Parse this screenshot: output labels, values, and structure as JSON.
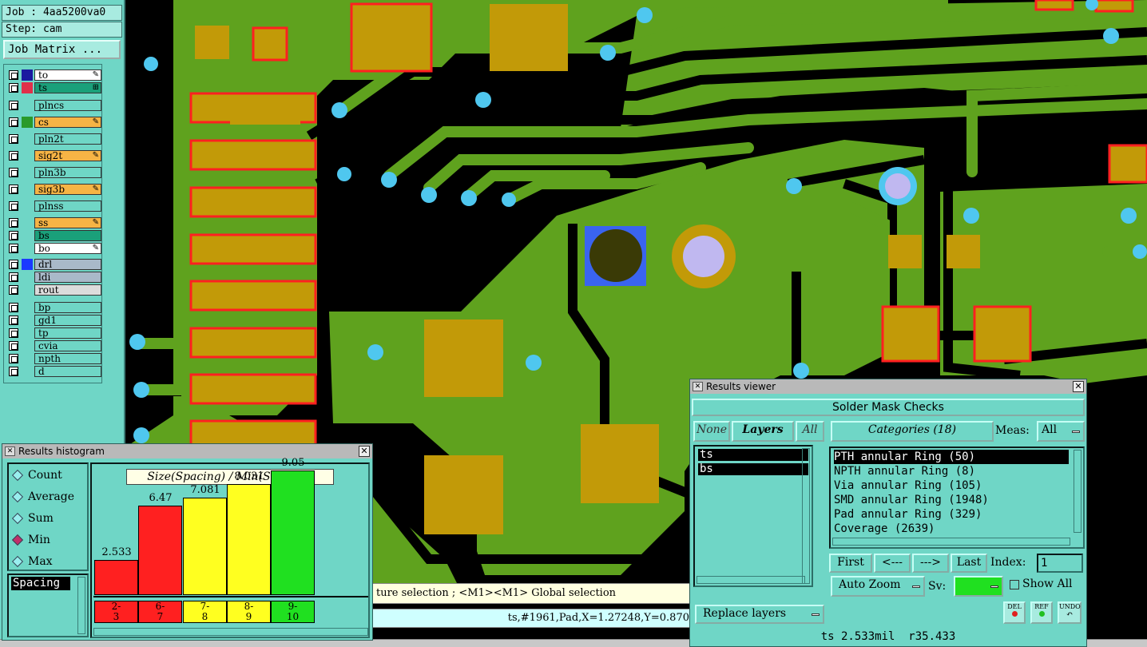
{
  "job": {
    "job_label": "Job : 4aa5200va0",
    "step_label": "Step: cam",
    "matrix_button": "Job Matrix ..."
  },
  "layers": [
    {
      "name": "to",
      "color": "#ffffff",
      "mark": "edit",
      "sel_color": "#1a1aa0"
    },
    {
      "name": "ts",
      "color": "#1aa07a",
      "mark": "grid",
      "sel_color": "#e0304a"
    },
    {
      "name": "plncs",
      "color": "#6fd6c6",
      "mark": "",
      "sel_color": ""
    },
    {
      "name": "cs",
      "color": "#f6b445",
      "mark": "edit",
      "sel_color": "#2a9a2a"
    },
    {
      "name": "pln2t",
      "color": "#6fd6c6",
      "mark": "",
      "sel_color": ""
    },
    {
      "name": "sig2t",
      "color": "#f6b445",
      "mark": "edit",
      "sel_color": ""
    },
    {
      "name": "pln3b",
      "color": "#6fd6c6",
      "mark": "",
      "sel_color": ""
    },
    {
      "name": "sig3b",
      "color": "#f6b445",
      "mark": "edit",
      "sel_color": ""
    },
    {
      "name": "plnss",
      "color": "#6fd6c6",
      "mark": "",
      "sel_color": ""
    },
    {
      "name": "ss",
      "color": "#f6b445",
      "mark": "edit",
      "sel_color": ""
    },
    {
      "name": "bs",
      "color": "#1aa07a",
      "mark": "",
      "sel_color": ""
    },
    {
      "name": "bo",
      "color": "#ffffff",
      "mark": "edit",
      "sel_color": ""
    },
    {
      "name": "drl",
      "color": "#a9b9c9",
      "mark": "",
      "sel_color": "#1a3aff"
    },
    {
      "name": "ldi",
      "color": "#a9b9c9",
      "mark": "",
      "sel_color": ""
    },
    {
      "name": "rout",
      "color": "#dcdcdc",
      "mark": "",
      "sel_color": ""
    },
    {
      "name": "bp",
      "color": "#6fd6c6",
      "mark": "",
      "sel_color": ""
    },
    {
      "name": "gd1",
      "color": "#6fd6c6",
      "mark": "",
      "sel_color": ""
    },
    {
      "name": "tp",
      "color": "#6fd6c6",
      "mark": "",
      "sel_color": ""
    },
    {
      "name": "cvia",
      "color": "#6fd6c6",
      "mark": "",
      "sel_color": ""
    },
    {
      "name": "npth",
      "color": "#6fd6c6",
      "mark": "",
      "sel_color": ""
    },
    {
      "name": "d",
      "color": "#6fd6c6",
      "mark": "",
      "sel_color": ""
    }
  ],
  "status_line": "ture selection ; <M1><M1> Global selection",
  "coord_line": "ts,#1961,Pad,X=1.27248,Y=0.870",
  "histogram": {
    "title": "Results histogram",
    "modes": [
      {
        "label": "Count",
        "selected": false
      },
      {
        "label": "Average",
        "selected": false
      },
      {
        "label": "Sum",
        "selected": false
      },
      {
        "label": "Min",
        "selected": true
      },
      {
        "label": "Max",
        "selected": false
      }
    ],
    "measure": "Spacing",
    "chart_title": "Size(Spacing) / Min(Spacing)",
    "colors": {
      "red": "#ff2020",
      "yellow": "#ffff20",
      "green": "#20e020"
    }
  },
  "chart_data": {
    "type": "bar",
    "title": "Size(Spacing) / Min(Spacing)",
    "categories": [
      "2-3",
      "6-7",
      "7-8",
      "8-9",
      "9-10"
    ],
    "category_labels": [
      [
        "2-",
        "3"
      ],
      [
        "6-",
        "7"
      ],
      [
        "7-",
        "8"
      ],
      [
        "8-",
        "9"
      ],
      [
        "9-",
        "10"
      ]
    ],
    "values": [
      2.533,
      6.47,
      7.081,
      8.031,
      9.05
    ],
    "value_labels": [
      "2.533",
      "6.47",
      "7.081",
      "8.031",
      "9.05"
    ],
    "bar_colors": [
      "red",
      "red",
      "yellow",
      "yellow",
      "green"
    ],
    "ylim": [
      0,
      10
    ]
  },
  "results": {
    "title": "Results viewer",
    "header": "Solder Mask Checks",
    "none_btn": "None",
    "layers_btn": "Layers",
    "all_btn": "All",
    "categories_btn": "Categories (18)",
    "meas_label": "Meas:",
    "meas_value": "All",
    "layer_items": [
      "ts",
      "bs"
    ],
    "categories": [
      "PTH annular Ring (50)",
      "NPTH annular Ring (8)",
      "Via annular Ring (105)",
      "SMD annular Ring (1948)",
      "Pad annular Ring (329)",
      "Coverage (2639)"
    ],
    "first_btn": "First",
    "prev_btn": "<---",
    "next_btn": "--->",
    "last_btn": "Last",
    "index_label": "Index:",
    "index_value": "1",
    "autozoom_btn": "Auto Zoom",
    "sv_label": "Sv:",
    "show_all_label": "Show All",
    "replace_btn": "Replace layers",
    "del_label": "DEL",
    "ref_label": "REF",
    "undo_label": "UNDO",
    "status": "ts 2.533mil  r35.433"
  }
}
